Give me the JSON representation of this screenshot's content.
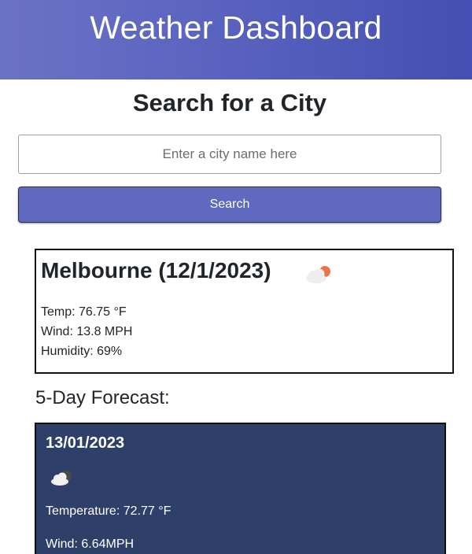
{
  "header": {
    "title": "Weather Dashboard"
  },
  "search": {
    "title": "Search for a City",
    "placeholder": "Enter a city name here",
    "button_label": "Search"
  },
  "current": {
    "title": "Melbourne (12/1/2023)",
    "icon": "partly-cloudy-sun-icon",
    "temp": "Temp: 76.75 °F",
    "wind": "Wind: 13.8 MPH",
    "humidity": "Humidity: 69%"
  },
  "forecast": {
    "heading": "5-Day Forecast:",
    "days": [
      {
        "date": "13/01/2023",
        "icon": "cloud-icon",
        "temperature": "Temperature: 72.77 °F",
        "wind": "Wind: 6.64MPH"
      }
    ]
  },
  "colors": {
    "header_gradient_start": "#6b72c6",
    "header_gradient_end": "#434fb2",
    "button": "#5e69bf",
    "forecast_card": "#2e3f69"
  }
}
